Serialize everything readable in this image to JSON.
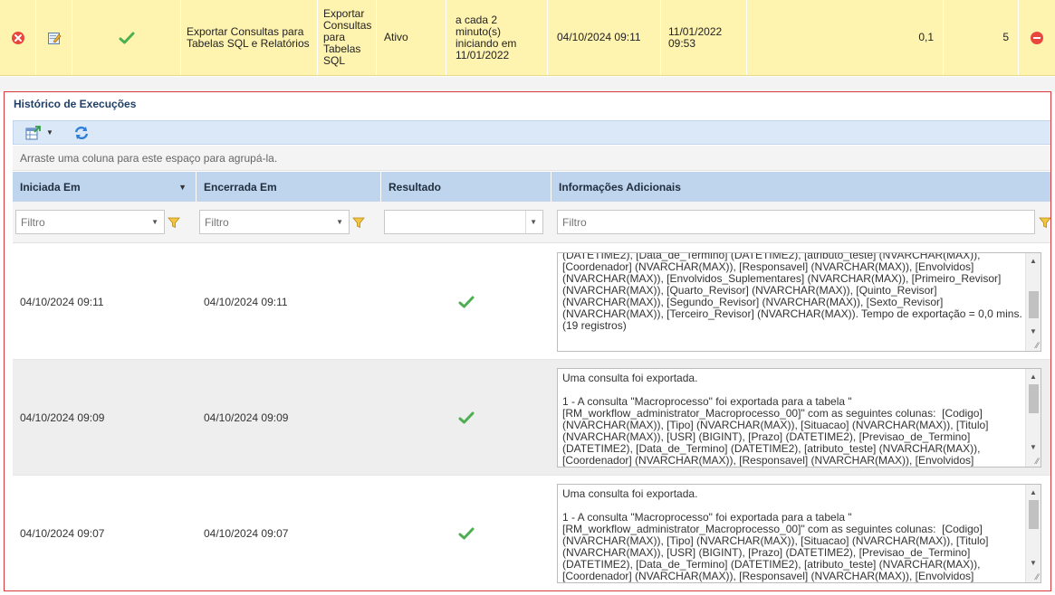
{
  "job": {
    "name": "Exportar Consultas para Tabelas SQL e Relatórios",
    "description": "Exportar Consultas para Tabelas SQL",
    "status": "Ativo",
    "schedule": "a cada 2 minuto(s) iniciando em 11/01/2022",
    "last_run": "04/10/2024 09:11",
    "next_run": "11/01/2022 09:53",
    "duration": "0,1",
    "count": "5"
  },
  "history": {
    "title": "Histórico de Execuções",
    "group_hint": "Arraste uma coluna para este espaço para agrupá-la.",
    "columns": [
      "Iniciada Em",
      "Encerrada Em",
      "Resultado",
      "Informações Adicionais"
    ],
    "filter_placeholder": "Filtro",
    "rows": [
      {
        "started": "04/10/2024 09:11",
        "ended": "04/10/2024 09:11",
        "result": "success",
        "info": "(DATETIME2), [Data_de_Termino] (DATETIME2), [atributo_teste] (NVARCHAR(MAX)), [Coordenador] (NVARCHAR(MAX)), [Responsavel] (NVARCHAR(MAX)), [Envolvidos] (NVARCHAR(MAX)), [Envolvidos_Suplementares] (NVARCHAR(MAX)), [Primeiro_Revisor] (NVARCHAR(MAX)), [Quarto_Revisor] (NVARCHAR(MAX)), [Quinto_Revisor] (NVARCHAR(MAX)), [Segundo_Revisor] (NVARCHAR(MAX)), [Sexto_Revisor] (NVARCHAR(MAX)), [Terceiro_Revisor] (NVARCHAR(MAX)). Tempo de exportação = 0,0 mins. (19 registros)"
      },
      {
        "started": "04/10/2024 09:09",
        "ended": "04/10/2024 09:09",
        "result": "success",
        "info": "Uma consulta foi exportada.\n\n1 - A consulta \"Macroprocesso\" foi exportada para a tabela \"[RM_workflow_administrator_Macroprocesso_00]\" com as seguintes colunas:  [Codigo] (NVARCHAR(MAX)), [Tipo] (NVARCHAR(MAX)), [Situacao] (NVARCHAR(MAX)), [Titulo] (NVARCHAR(MAX)), [USR] (BIGINT), [Prazo] (DATETIME2), [Previsao_de_Termino] (DATETIME2), [Data_de_Termino] (DATETIME2), [atributo_teste] (NVARCHAR(MAX)), [Coordenador] (NVARCHAR(MAX)), [Responsavel] (NVARCHAR(MAX)), [Envolvidos]"
      },
      {
        "started": "04/10/2024 09:07",
        "ended": "04/10/2024 09:07",
        "result": "success",
        "info": "Uma consulta foi exportada.\n\n1 - A consulta \"Macroprocesso\" foi exportada para a tabela \"[RM_workflow_administrator_Macroprocesso_00]\" com as seguintes colunas:  [Codigo] (NVARCHAR(MAX)), [Tipo] (NVARCHAR(MAX)), [Situacao] (NVARCHAR(MAX)), [Titulo] (NVARCHAR(MAX)), [USR] (BIGINT), [Prazo] (DATETIME2), [Previsao_de_Termino] (DATETIME2), [Data_de_Termino] (DATETIME2), [atributo_teste] (NVARCHAR(MAX)), [Coordenador] (NVARCHAR(MAX)), [Responsavel] (NVARCHAR(MAX)), [Envolvidos]"
      }
    ]
  },
  "icons": {
    "delete": "delete-circle-icon",
    "edit": "edit-icon",
    "ok": "check-icon",
    "stop": "stop-circle-icon",
    "export": "export-icon",
    "refresh": "refresh-icon",
    "filter": "funnel-icon"
  },
  "colors": {
    "job_row_bg": "#fff3b0",
    "panel_border": "#d9373b",
    "header_bg": "#bfd5ee",
    "check_green": "#4caf50"
  }
}
